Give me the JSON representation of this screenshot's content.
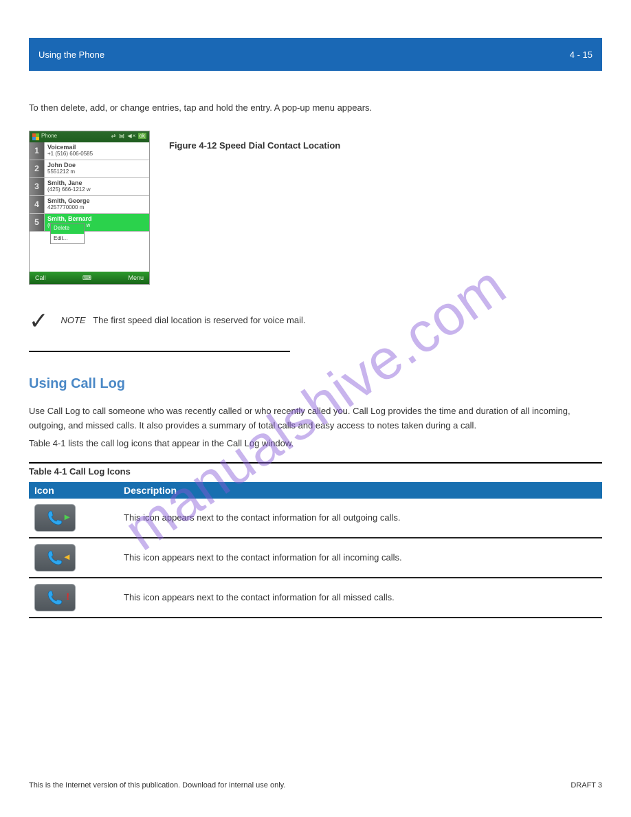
{
  "header": {
    "left": "Using the Phone",
    "right": "4 - 15"
  },
  "para1": "To then delete, add, or change entries, tap and hold the entry. A pop-up menu appears.",
  "screenshot": {
    "topbar_title": "Phone",
    "topbar_icons": "ok",
    "entries": [
      {
        "name": "Voicemail",
        "detail": "+1 (516) 606-0585"
      },
      {
        "name": "John Doe",
        "detail": "5551212 m"
      },
      {
        "name": "Smith, Jane",
        "detail": "(425) 666-1212 w"
      },
      {
        "name": "Smith, George",
        "detail": "4257770000 m"
      },
      {
        "name": "Smith, Bernard",
        "detail": "(6__________) w"
      }
    ],
    "context_menu": {
      "item1": "Delete",
      "item2": "Edit..."
    },
    "bottom_left": "Call",
    "bottom_right": "Menu"
  },
  "fignote": "Figure 4-12 Speed Dial Contact Location",
  "note_label": "NOTE",
  "note_text": "The first speed dial location is reserved for voice mail.",
  "section_heading": "Using Call Log",
  "section_text1": "Use Call Log to call someone who was recently called or who recently called you. Call Log provides the time and duration of all incoming, outgoing, and missed calls. It also provides a summary of total calls and easy access to notes taken during a call.",
  "section_text2": "Table 4-1 lists the call log icons that appear in the Call Log window.",
  "table": {
    "caption": "Table 4-1 Call Log Icons",
    "col1": "Icon",
    "col2": "Description",
    "rows": [
      {
        "desc": "This icon appears next to the contact information for all outgoing calls."
      },
      {
        "desc": "This icon appears next to the contact information for all incoming calls."
      },
      {
        "desc": "This icon appears next to the contact information for all missed calls."
      }
    ]
  },
  "footer": {
    "left": "This is the Internet version of this publication. Download for internal use only.",
    "right": "DRAFT 3"
  },
  "watermark": "manualshive.com"
}
